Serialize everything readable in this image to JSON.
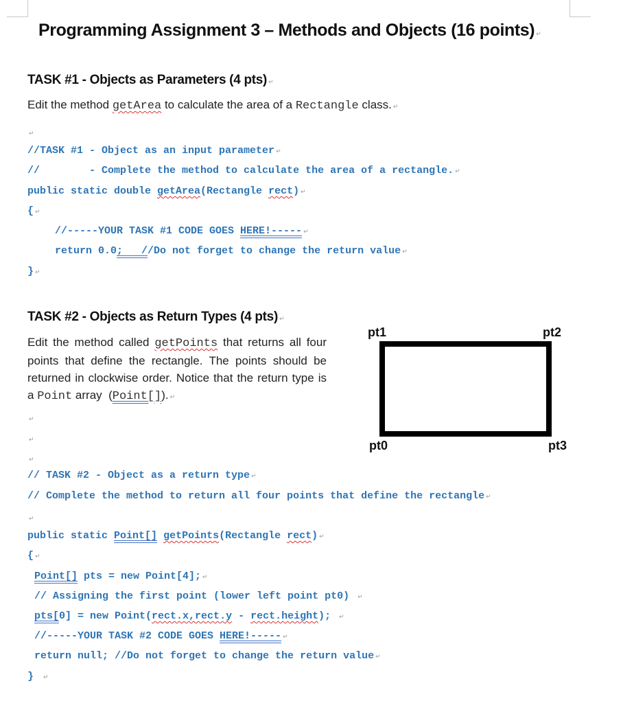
{
  "page": {
    "title": "Programming Assignment 3 – Methods and Objects (16 points)",
    "paragraph_mark": "↵"
  },
  "task1": {
    "heading": "TASK #1 - Objects as Parameters (4 pts)",
    "instruction_pre": "Edit the method ",
    "instruction_code1": "getArea",
    "instruction_mid": " to calculate the area of a ",
    "instruction_code2": "Rectangle",
    "instruction_post": " class.",
    "code": {
      "line1": "//TASK #1 - Object as an input parameter",
      "line2": "//        - Complete the method to calculate the area of a rectangle.",
      "line3_pre": "public static double ",
      "line3_method": "getArea",
      "line3_mid": "(Rectangle ",
      "line3_param": "rect",
      "line3_post": ")",
      "open_brace": "{",
      "line4_pre": "//-----YOUR TASK #1 CODE GOES ",
      "line4_here": "HERE!-----",
      "line5_pre": "return 0.0",
      "line5_semi": ";   /",
      "line5_post": "/Do not forget to change the return value",
      "close_brace": "}"
    }
  },
  "task2": {
    "heading": "TASK #2 - Objects as Return Types (4 pts)",
    "para_pre": "Edit the method called ",
    "para_code1": "getPoints",
    "para_mid": " that returns all four points that define the rectangle. The points should be returned in clockwise order. Notice that the return type is a ",
    "para_code2": "Point",
    "para_mid2": " array  (",
    "para_code3": "Point[]",
    "para_post": ").",
    "diagram": {
      "labels": [
        "pt1",
        "pt2",
        "pt0",
        "pt3"
      ]
    },
    "code": {
      "line1": "// TASK #2 - Object as a return type",
      "line2": "// Complete the method to return all four points that define the rectangle",
      "line3_pre": "public static ",
      "line3_type": "Point[]",
      "line3_sp": " ",
      "line3_method": "getPoints",
      "line3_mid": "(Rectangle ",
      "line3_param": "rect",
      "line3_post": ")",
      "open_brace": "{",
      "line4_type": "Point[]",
      "line4_post": " pts = new Point[4];",
      "line5": "// Assigning the first point (lower left point pt0)",
      "line6_var": "pts[",
      "line6_a": "0] = new Point(",
      "line6_b": "rect.x,rect.y",
      "line6_c": " - ",
      "line6_d": "rect.height",
      "line6_e": ");",
      "line7_pre": "//-----YOUR TASK #2 CODE GOES ",
      "line7_here": "HERE!-----",
      "line8": "return null; //Do not forget to change the return value",
      "close_brace": "}"
    }
  }
}
